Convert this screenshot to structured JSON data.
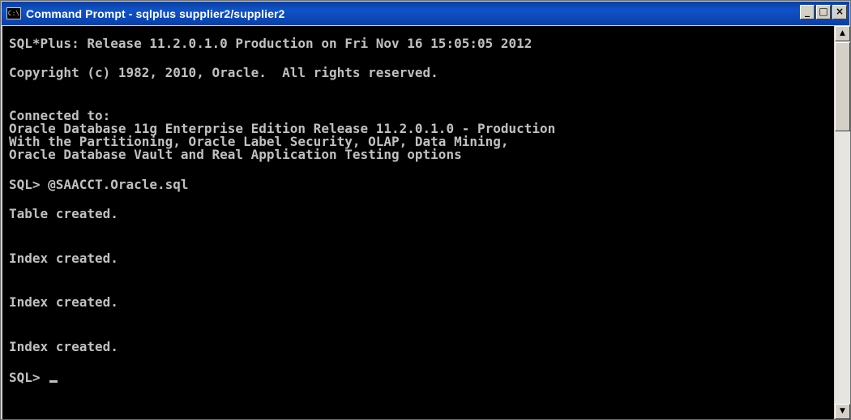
{
  "window": {
    "title": "Command Prompt - sqlplus supplier2/supplier2",
    "app_icon": "console-icon",
    "icon_glyph": "C:\\",
    "buttons": {
      "minimize": "_",
      "maximize": "□",
      "close": "×"
    }
  },
  "console": {
    "banner": "SQL*Plus: Release 11.2.0.1.0 Production on Fri Nov 16 15:05:05 2012",
    "copyright": "Copyright (c) 1982, 2010, Oracle.  All rights reserved.",
    "connected": "Connected to:",
    "db_line1": "Oracle Database 11g Enterprise Edition Release 11.2.0.1.0 - Production",
    "db_line2": "With the Partitioning, Oracle Label Security, OLAP, Data Mining,",
    "db_line3": "Oracle Database Vault and Real Application Testing options",
    "command": "SQL> @SAACCT.Oracle.sql",
    "result1": "Table created.",
    "result2": "Index created.",
    "result3": "Index created.",
    "result4": "Index created.",
    "prompt": "SQL> "
  },
  "colors": {
    "titlebar": "#0f52c9",
    "console_bg": "#000000",
    "console_text": "#c0c0c0"
  },
  "scrollbar": {
    "up_arrow": "▲",
    "down_arrow": "▼"
  }
}
